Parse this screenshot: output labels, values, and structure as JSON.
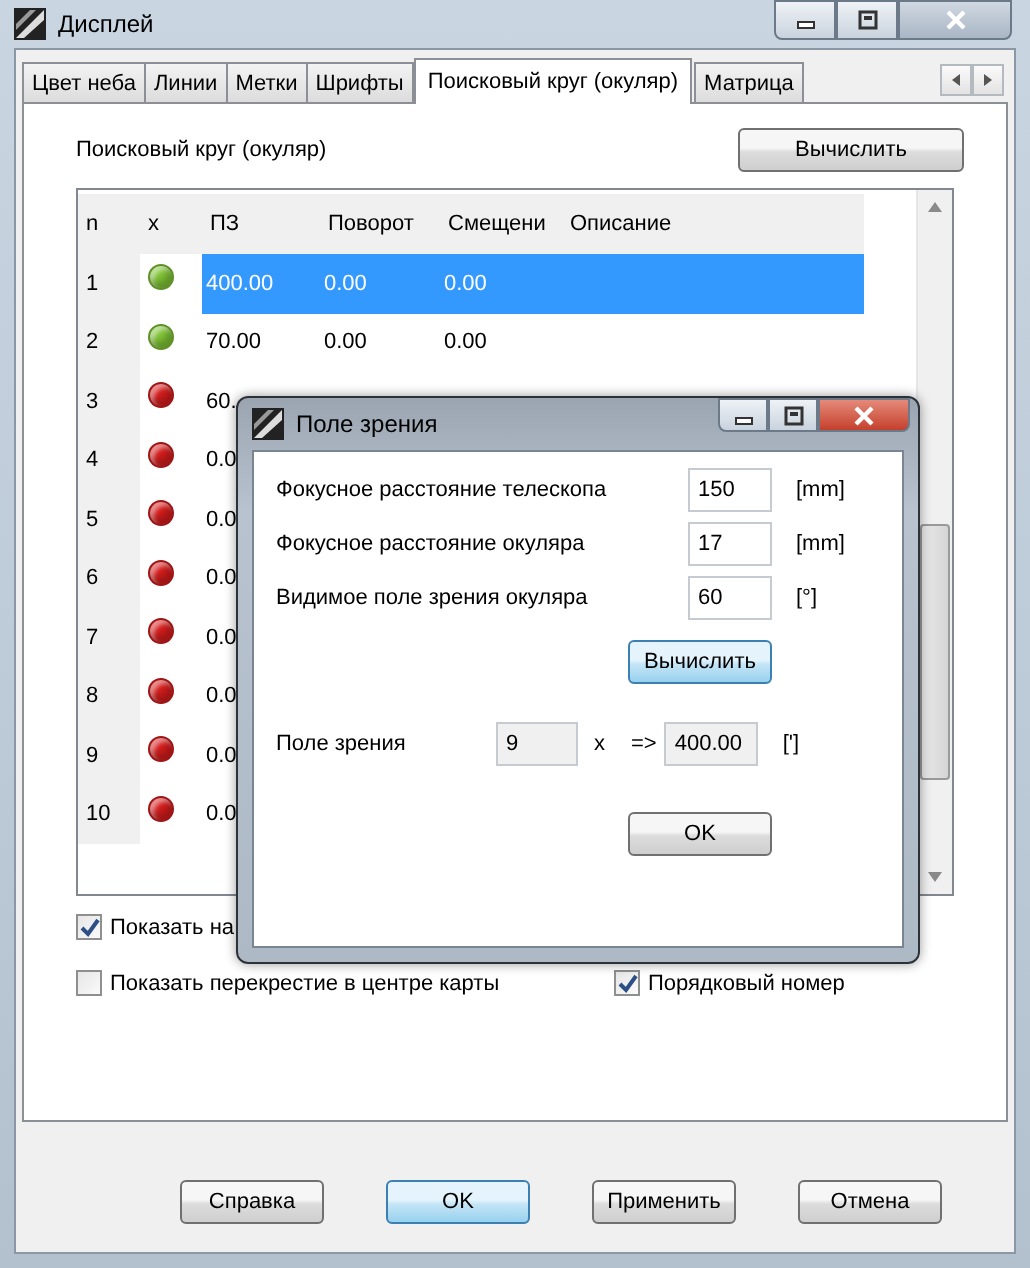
{
  "window": {
    "title": "Дисплей"
  },
  "tabs": [
    {
      "label": "Цвет неба",
      "selected": false
    },
    {
      "label": "Линии",
      "selected": false
    },
    {
      "label": "Метки",
      "selected": false
    },
    {
      "label": "Шрифты",
      "selected": false
    },
    {
      "label": "Поисковый круг (окуляр)",
      "selected": true
    },
    {
      "label": "Матрица",
      "selected": false
    }
  ],
  "panel": {
    "title": "Поисковый круг (окуляр)",
    "compute_button": "Вычислить"
  },
  "table": {
    "columns": [
      "n",
      "x",
      "ПЗ",
      "Поворот",
      "Смещени",
      "Описание"
    ],
    "rows": [
      {
        "color": "#7ec234",
        "cells": [
          "1",
          "",
          "400.00",
          "0.00",
          "0.00"
        ],
        "selected": true
      },
      {
        "color": "#7ec234",
        "cells": [
          "2",
          "",
          "70.00",
          "0.00",
          "0.00"
        ],
        "selected": false
      },
      {
        "color": "#d41c1c",
        "cells": [
          "3",
          "",
          "60."
        ],
        "selected": false
      },
      {
        "color": "#d41c1c",
        "cells": [
          "4",
          "",
          "0.0"
        ],
        "selected": false
      },
      {
        "color": "#d41c1c",
        "cells": [
          "5",
          "",
          "0.0"
        ],
        "selected": false
      },
      {
        "color": "#d41c1c",
        "cells": [
          "6",
          "",
          "0.0"
        ],
        "selected": false
      },
      {
        "color": "#d41c1c",
        "cells": [
          "7",
          "",
          "0.0"
        ],
        "selected": false
      },
      {
        "color": "#d41c1c",
        "cells": [
          "8",
          "",
          "0.0"
        ],
        "selected": false
      },
      {
        "color": "#d41c1c",
        "cells": [
          "9",
          "",
          "0.0"
        ],
        "selected": false
      },
      {
        "color": "#d41c1c",
        "cells": [
          "10",
          "",
          "0.0"
        ],
        "selected": false
      }
    ]
  },
  "checkboxes": [
    {
      "label": "Показать на",
      "checked": true
    },
    {
      "label": "Показать перекрестие в центре карты",
      "checked": false
    },
    {
      "label": "Порядковый номер",
      "checked": true
    }
  ],
  "buttons": [
    {
      "label": "Справка",
      "default": false
    },
    {
      "label": "OK",
      "default": true
    },
    {
      "label": "Применить",
      "default": false
    },
    {
      "label": "Отмена",
      "default": false
    }
  ],
  "dialog": {
    "title": "Поле зрения",
    "fields": [
      {
        "label": "Фокусное расстояние телескопа",
        "value": "150",
        "unit": "[mm]"
      },
      {
        "label": "Фокусное расстояние окуляра",
        "value": "17",
        "unit": "[mm]"
      },
      {
        "label": "Видимое поле зрения окуляра",
        "value": "60",
        "unit": "[°]"
      }
    ],
    "compute_button": {
      "label": "Вычислить",
      "default": true
    },
    "result": {
      "label": "Поле зрения",
      "magnification": "9",
      "times": "x",
      "arrow": "=>",
      "value": "400.00",
      "unit": "[']"
    },
    "ok_button": {
      "label": "OK",
      "default": false
    }
  }
}
